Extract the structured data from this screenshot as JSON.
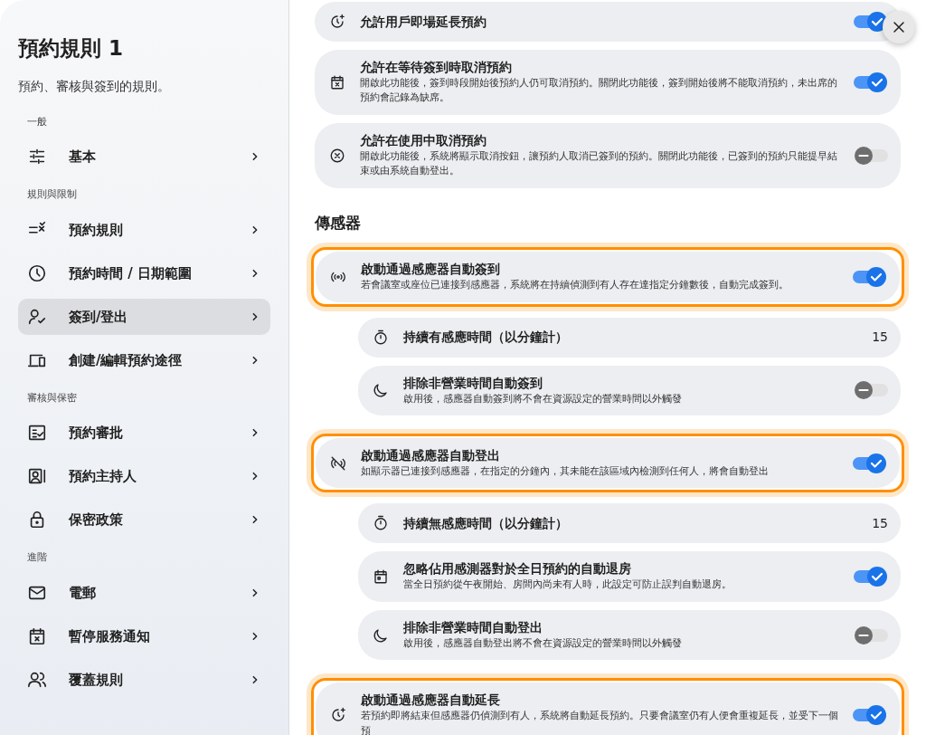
{
  "sidebar": {
    "title": "預約規則 1",
    "subtitle": "預約、審核與簽到的規則。",
    "groups": [
      {
        "label": "一般",
        "items": [
          {
            "label": "基本",
            "selected": false
          }
        ]
      },
      {
        "label": "規則與限制",
        "items": [
          {
            "label": "預約規則",
            "selected": false
          },
          {
            "label": "預約時間 / 日期範圍",
            "selected": false
          },
          {
            "label": "簽到/登出",
            "selected": true
          },
          {
            "label": "創建/編輯預約途徑",
            "selected": false
          }
        ]
      },
      {
        "label": "審核與保密",
        "items": [
          {
            "label": "預約審批",
            "selected": false
          },
          {
            "label": "預約主持人",
            "selected": false
          },
          {
            "label": "保密政策",
            "selected": false
          }
        ]
      },
      {
        "label": "進階",
        "items": [
          {
            "label": "電郵",
            "selected": false
          },
          {
            "label": "暫停服務通知",
            "selected": false
          },
          {
            "label": "覆蓋規則",
            "selected": false
          }
        ]
      }
    ]
  },
  "top_settings": [
    {
      "kind": "toggle",
      "title": "允許用戶即場延長預約",
      "on": true
    },
    {
      "kind": "toggle",
      "title": "允許在等待簽到時取消預約",
      "description": "開啟此功能後，簽到時段開始後預約人仍可取消預約。關閉此功能後，簽到開始後將不能取消預約，未出席的預約會記錄為缺席。",
      "on": true
    },
    {
      "kind": "toggle",
      "title": "允許在使用中取消預約",
      "description": "開啟此功能後，系統將顯示取消按鈕，讓預約人取消已簽到的預約。關閉此功能後，已簽到的預約只能提早結束或由系統自動登出。",
      "on": false
    }
  ],
  "sections": [
    {
      "heading": "傳感器",
      "groups": [
        {
          "highlighted": true,
          "main": {
            "kind": "toggle",
            "title": "啟動通過感應器自動簽到",
            "description": "若會議室或座位已連接到感應器，系統將在持續偵測到有人存在達指定分鐘數後，自動完成簽到。",
            "on": true
          },
          "children": [
            {
              "kind": "value",
              "title": "持續有感應時間（以分鐘計）",
              "value": "15"
            },
            {
              "kind": "toggle",
              "title": "排除非營業時間自動簽到",
              "description": "啟用後，感應器自動簽到將不會在資源設定的營業時間以外觸發",
              "on": false
            }
          ]
        },
        {
          "highlighted": true,
          "main": {
            "kind": "toggle",
            "title": "啟動通過感應器自動登出",
            "description": "如顯示器已連接到感應器，在指定的分鐘內，其未能在該區域內檢測到任何人，將會自動登出",
            "on": true
          },
          "children": [
            {
              "kind": "value",
              "title": "持續無感應時間（以分鐘計）",
              "value": "15"
            },
            {
              "kind": "toggle",
              "title": "忽略佔用感測器對於全日預約的自動退房",
              "description": "當全日預約從午夜開始、房間內尚未有人時，此設定可防止誤判自動退房。",
              "on": true
            },
            {
              "kind": "toggle",
              "title": "排除非營業時間自動登出",
              "description": "啟用後，感應器自動登出將不會在資源設定的營業時間以外觸發",
              "on": false
            }
          ]
        },
        {
          "highlighted": true,
          "main": {
            "kind": "toggle",
            "title": "啟動通過感應器自動延長",
            "description": "若預約即將結束但感應器仍偵測到有人，系統將自動延長預約。只要會議室仍有人便會重複延長，並受下一個預",
            "on": true
          }
        }
      ]
    }
  ]
}
